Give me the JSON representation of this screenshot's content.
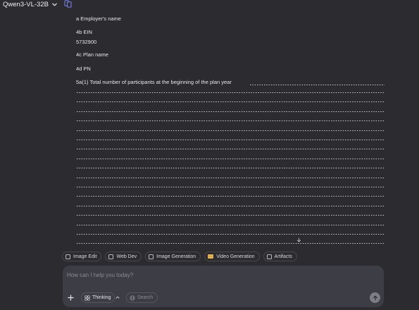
{
  "topbar": {
    "model_name": "Qwen3-VL-32B"
  },
  "message": {
    "lines": [
      "a Employer's name",
      "4b EIN",
      "5732900",
      "4c Plan name",
      "4d PN",
      "5a(1) Total number of participants at the beginning of the plan year"
    ]
  },
  "toolbar": {
    "chips": [
      "Image Edit",
      "Web Dev",
      "Image Generation",
      "Video Generation",
      "Artifacts"
    ]
  },
  "composer": {
    "placeholder": "How can I help you today?",
    "thinking_label": "Thinking",
    "search_label": "Search"
  }
}
